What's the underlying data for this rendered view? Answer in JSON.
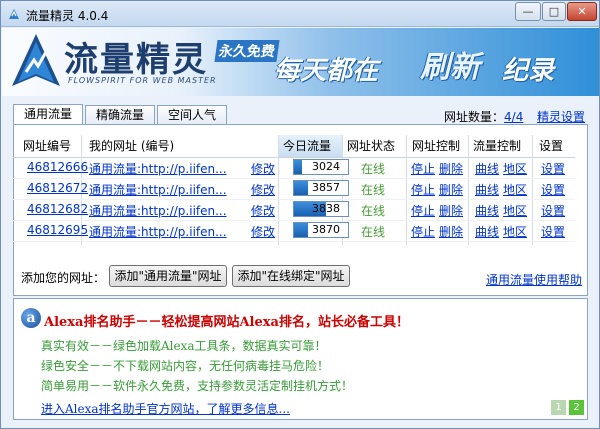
{
  "window": {
    "title": "流量精灵 4.0.4",
    "minimize": "—",
    "maximize": "□",
    "close": "✕"
  },
  "banner": {
    "logo": "流量精灵",
    "logo_sub": "FLOWSPIRIT FOR WEB MASTER",
    "free": "永久免费",
    "slogan_1": "每天都在",
    "slogan_2": "刷新",
    "slogan_3": "纪录"
  },
  "tabs": [
    "通用流量",
    "精确流量",
    "空间人气"
  ],
  "site_count": {
    "label": "网址数量：",
    "value": "4/4"
  },
  "settings_link": "精灵设置",
  "table": {
    "headers": [
      "网址编号",
      "我的网址 (编号)",
      "今日流量",
      "网址状态",
      "网址控制",
      "流量控制",
      "设置"
    ],
    "rows": [
      {
        "id": "46812666",
        "url": "通用流量:http://p.iifen...",
        "edit": "修改",
        "traffic": "3024",
        "status": "在线",
        "stop": "停止",
        "delete": "删除",
        "curve": "曲线",
        "region": "地区",
        "settings": "设置"
      },
      {
        "id": "46812672",
        "url": "通用流量:http://p.iifen...",
        "edit": "修改",
        "traffic": "3857",
        "status": "在线",
        "stop": "停止",
        "delete": "删除",
        "curve": "曲线",
        "region": "地区",
        "settings": "设置"
      },
      {
        "id": "46812682",
        "url": "通用流量:http://p.iifen...",
        "edit": "修改",
        "traffic": "3838",
        "status": "在线",
        "stop": "停止",
        "delete": "删除",
        "curve": "曲线",
        "region": "地区",
        "settings": "设置"
      },
      {
        "id": "46812695",
        "url": "通用流量:http://p.iifen...",
        "edit": "修改",
        "traffic": "3870",
        "status": "在线",
        "stop": "停止",
        "delete": "删除",
        "curve": "曲线",
        "region": "地区",
        "settings": "设置"
      }
    ],
    "traffic_fill": [
      0.15,
      0.25,
      0.6,
      0.25
    ]
  },
  "add_site": {
    "label": "添加您的网址：",
    "button_general": "添加\"通用流量\"网址",
    "button_online": "添加\"在线绑定\"网址"
  },
  "help_link": "通用流量使用帮助",
  "ad": {
    "icon": "a",
    "title": "Alexa排名助手－－轻松提高网站Alexa排名，站长必备工具！",
    "lines": [
      "真实有效－－绿色加载Alexa工具条，数据真实可靠！",
      "绿色安全－－不下载网站内容，无任何病毒挂马危险！",
      "简单易用－－软件永久免费，支持参数灵活定制挂机方式！"
    ],
    "link": "进入Alexa排名助手官方网站，了解更多信息...",
    "pages": [
      "1",
      "2"
    ]
  },
  "colors": {
    "accent": "#0033cc",
    "online": "#4a9a3a",
    "ad_title": "#cc0000"
  }
}
